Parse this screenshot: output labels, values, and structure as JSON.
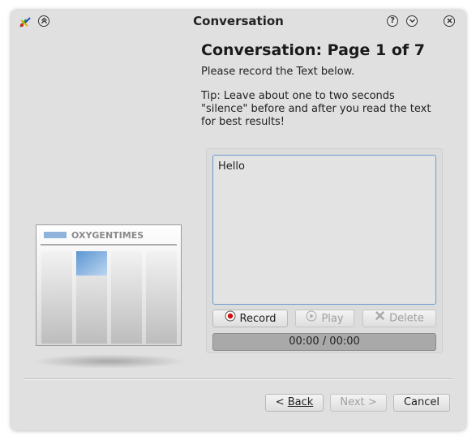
{
  "window": {
    "title": "Conversation"
  },
  "page": {
    "heading": "Conversation: Page 1 of 7",
    "description": "Please record the Text below.",
    "tip": "Tip: Leave about one to two seconds \"silence\" before and after you read the text for best results!"
  },
  "illustration": {
    "brand": "OXYGENTIMES"
  },
  "recorder": {
    "text": "Hello",
    "record_label": "Record",
    "play_label": "Play",
    "delete_label": "Delete",
    "time": "00:00 / 00:00"
  },
  "nav": {
    "back_label": "Back",
    "back_prefix": "< ",
    "next_label": "Next >",
    "cancel_label": "Cancel"
  },
  "colors": {
    "accent": "#6a9bd0",
    "record_red": "#d01010"
  },
  "icons": {
    "titlebar": [
      "app-icon",
      "keep-above-icon",
      "help-icon",
      "minimize-icon",
      "close-icon"
    ],
    "record": "record-icon",
    "play": "play-icon",
    "delete": "delete-icon"
  }
}
